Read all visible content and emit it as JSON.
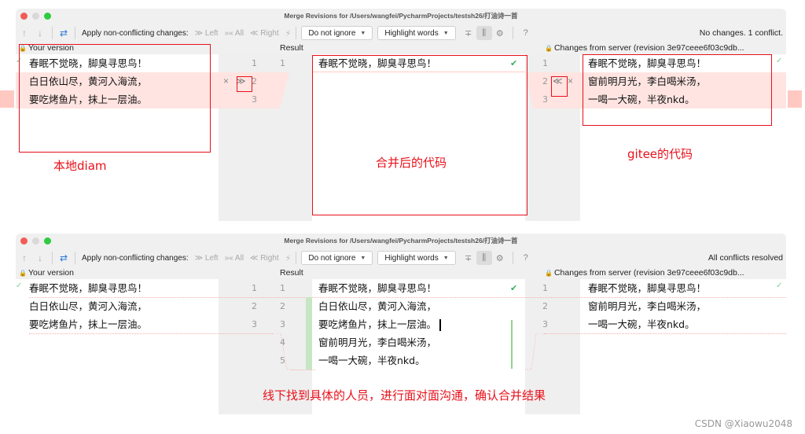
{
  "windows": [
    {
      "title": "Merge Revisions for /Users/wangfei/PycharmProjects/testsh26/打油诗一首",
      "toolbar": {
        "prev_icon": "arrow-up-icon",
        "next_icon": "arrow-down-icon",
        "magic_icon": "magic-resolve-icon",
        "apply_label": "Apply non-conflicting changes:",
        "left_label": "≫ Left",
        "all_label": "»« All",
        "right_label": "≪ Right",
        "ignore_dropdown": "Do not ignore",
        "highlight_dropdown": "Highlight words",
        "status": "No changes. 1 conflict."
      },
      "headers": {
        "left": "Your version",
        "middle": "Result",
        "right": "Changes from server (revision 3e97ceee6f03c9db..."
      },
      "left_lines": [
        "春眠不觉晓，脚臭寻思鸟！",
        "白日依山尽，黄河入海流，",
        "要吃烤鱼片，抹上一层油。"
      ],
      "left_line_numbers": [
        "1",
        "2",
        "3"
      ],
      "result_line_numbers": [
        "1"
      ],
      "result_lines": [
        "春眠不觉晓，脚臭寻思鸟！"
      ],
      "right_line_numbers": [
        "1",
        "2",
        "3"
      ],
      "right_lines": [
        "春眠不觉晓，脚臭寻思鸟！",
        "窗前明月光，李白喝米汤，",
        "一喝一大碗，半夜nkd。"
      ],
      "annotations": {
        "left": "本地diam",
        "middle": "合并后的代码",
        "right": "gitee的代码"
      }
    },
    {
      "title": "Merge Revisions for /Users/wangfei/PycharmProjects/testsh26/打油诗一首",
      "toolbar": {
        "apply_label": "Apply non-conflicting changes:",
        "left_label": "≫ Left",
        "all_label": "»« All",
        "right_label": "≪ Right",
        "ignore_dropdown": "Do not ignore",
        "highlight_dropdown": "Highlight words",
        "status": "All conflicts resolved"
      },
      "headers": {
        "left": "Your version",
        "middle": "Result",
        "right": "Changes from server (revision 3e97ceee6f03c9db..."
      },
      "left_lines": [
        "春眠不觉晓，脚臭寻思鸟！",
        "白日依山尽，黄河入海流，",
        "要吃烤鱼片，抹上一层油。"
      ],
      "left_line_numbers": [
        "1",
        "2",
        "3"
      ],
      "result_line_numbers": [
        "1",
        "2",
        "3",
        "4",
        "5"
      ],
      "result_lines": [
        "春眠不觉晓，脚臭寻思鸟！",
        "白日依山尽，黄河入海流，",
        "要吃烤鱼片，抹上一层油。",
        "窗前明月光，李白喝米汤，",
        "一喝一大碗，半夜nkd。"
      ],
      "right_line_numbers": [
        "1",
        "2",
        "3"
      ],
      "right_lines": [
        "春眠不觉晓，脚臭寻思鸟！",
        "窗前明月光，李白喝米汤，",
        "一喝一大碗，半夜nkd。"
      ],
      "annotations": {
        "bottom": "线下找到具体的人员，进行面对面沟通，确认合并结果"
      }
    }
  ],
  "watermark": "CSDN @Xiaowu2048",
  "colors": {
    "annotation_red": "#e8101a",
    "conflict_bg": "#ffe4e1",
    "added_green": "#c7e6c3"
  }
}
